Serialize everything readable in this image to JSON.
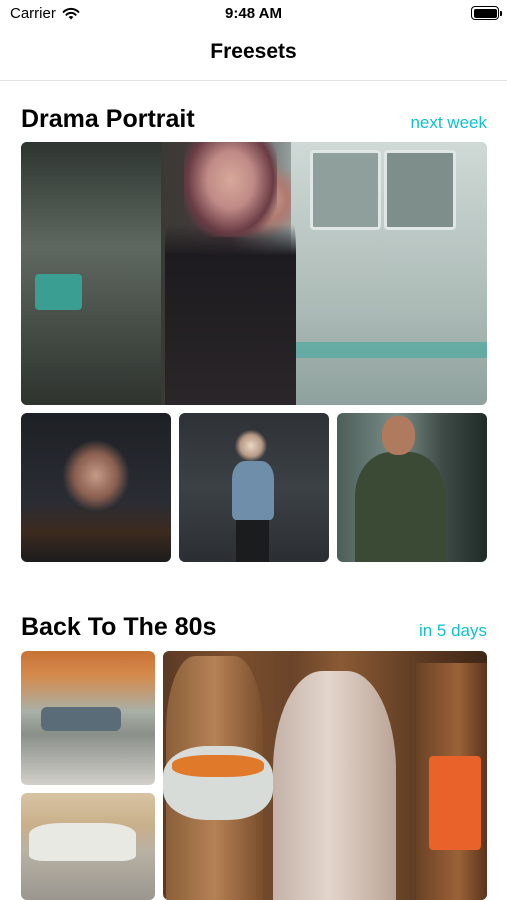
{
  "status_bar": {
    "carrier": "Carrier",
    "time": "9:48 AM",
    "wifi_icon": "wifi-icon",
    "battery_icon": "battery-icon"
  },
  "nav": {
    "title": "Freesets"
  },
  "sections": [
    {
      "title": "Drama Portrait",
      "eta": "next week",
      "photos": [
        "woman-leather-jacket-photo",
        "woman-portrait-photo",
        "woman-denim-jacket-photo",
        "bearded-man-photo"
      ]
    },
    {
      "title": "Back To The 80s",
      "eta": "in 5 days",
      "photos": [
        "street-scene-photo",
        "vintage-car-photo",
        "bottles-photo"
      ]
    }
  ],
  "colors": {
    "accent": "#11c0cc",
    "text": "#000000",
    "background": "#ffffff",
    "divider": "#e2e2e2"
  }
}
